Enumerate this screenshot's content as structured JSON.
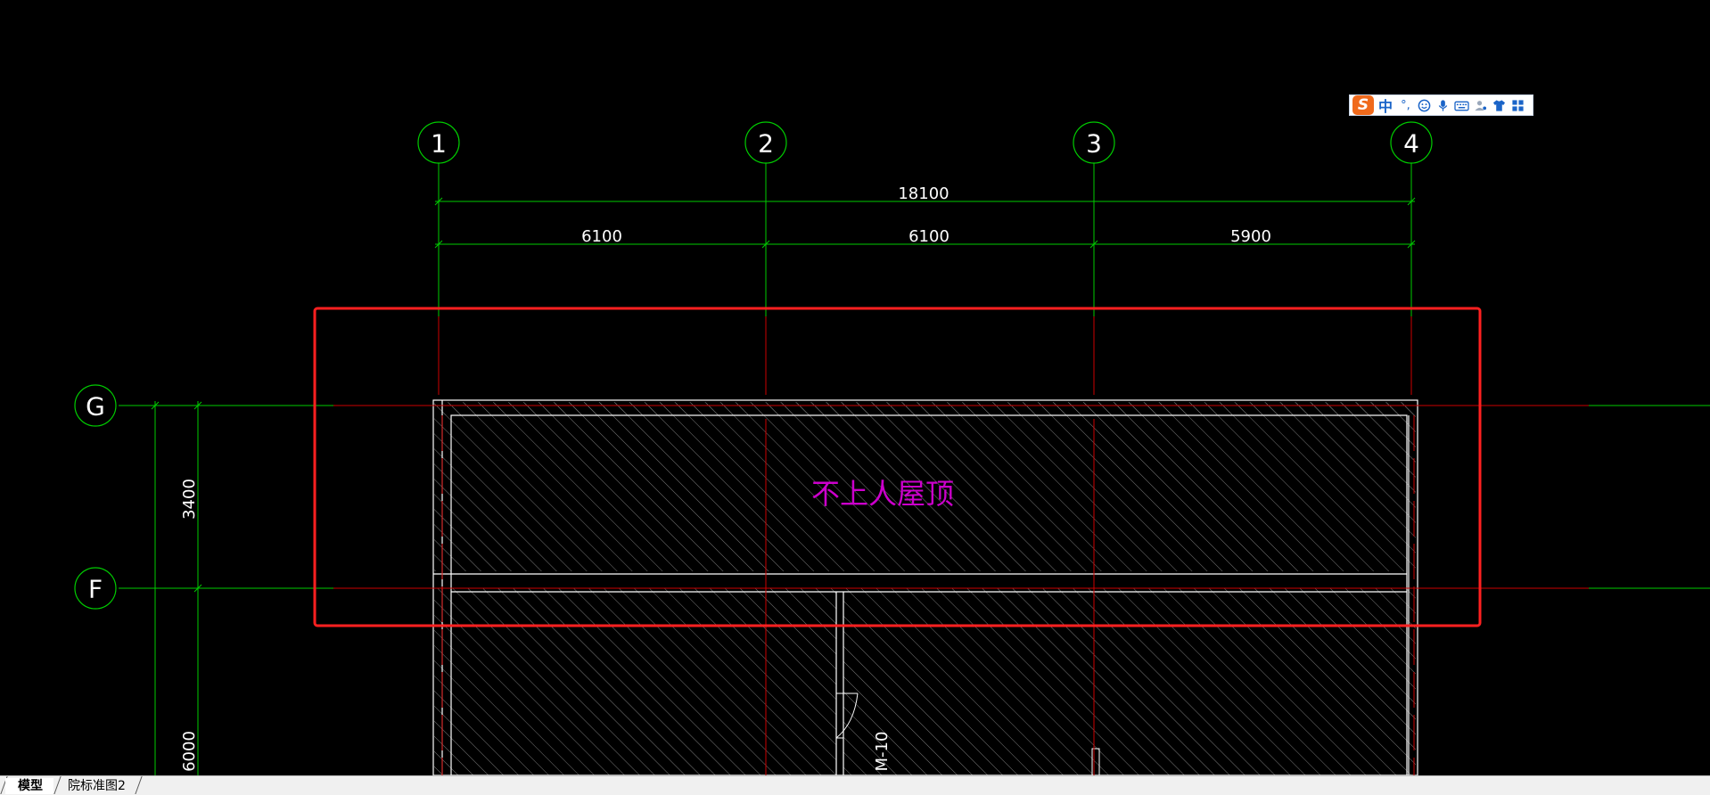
{
  "drawing": {
    "grid_bubbles": [
      {
        "label": "1"
      },
      {
        "label": "2"
      },
      {
        "label": "3"
      },
      {
        "label": "4"
      },
      {
        "label": "G"
      },
      {
        "label": "F"
      }
    ],
    "dimensions": {
      "total_horizontal": "18100",
      "spans": [
        "6100",
        "6100",
        "5900"
      ],
      "vertical_upper": "3400",
      "vertical_lower": "6000"
    },
    "room_label": "不上人屋顶",
    "door_tag": "M-10",
    "colors": {
      "background": "#000000",
      "grid_lines": "#00cc00",
      "axis_lines": "#cc0000",
      "walls": "#ffffff",
      "hatch": "#8a8a8a",
      "room_text": "#cc00cc",
      "highlight_box": "#ff2020"
    }
  },
  "ime_toolbar": {
    "logo": "S",
    "lang": "中",
    "punct": "°,",
    "icons": [
      "emoji-icon",
      "mic-icon",
      "keyboard-icon",
      "user-icon",
      "skin-icon",
      "grid-icon"
    ]
  },
  "tabs": [
    {
      "label": "模型",
      "active": true
    },
    {
      "label": "院标准图2",
      "active": false
    }
  ]
}
